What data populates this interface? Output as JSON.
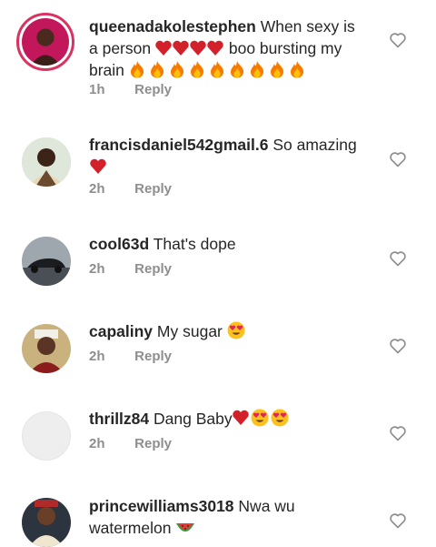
{
  "comments": [
    {
      "username": "queenadakolestephen",
      "text_a": "When sexy is a person",
      "text_b": "boo bursting my brain",
      "time": "1h",
      "reply_label": "Reply"
    },
    {
      "username": "francisdaniel542gmail.6",
      "text": "So amazing",
      "time": "2h",
      "reply_label": "Reply"
    },
    {
      "username": "cool63d",
      "text": "That's dope",
      "time": "2h",
      "reply_label": "Reply"
    },
    {
      "username": "capaliny",
      "text": "My sugar",
      "time": "2h",
      "reply_label": "Reply"
    },
    {
      "username": "thrillz84",
      "text": "Dang Baby",
      "time": "2h",
      "reply_label": "Reply"
    },
    {
      "username": "princewilliams3018",
      "text": "Nwa wu watermelon",
      "time": "",
      "reply_label": ""
    }
  ],
  "colors": {
    "heart_emoji": "#d3212c",
    "meta": "#8e8e8e",
    "story_ring": "#d9345f"
  },
  "icons": [
    "heart-outline-icon",
    "red-heart-emoji",
    "fire-emoji",
    "heart-eyes-emoji",
    "watermelon-emoji"
  ]
}
